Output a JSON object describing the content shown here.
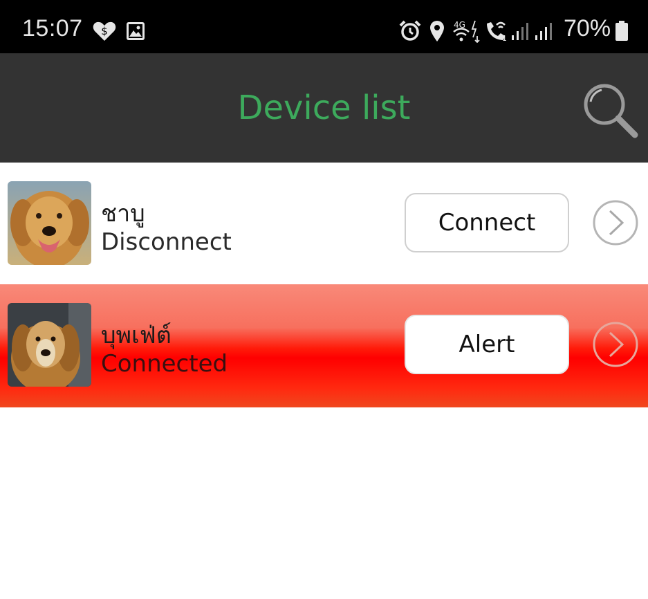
{
  "status_bar": {
    "time": "15:07",
    "battery": "70%",
    "left_icons": [
      "vpn-heart-icon",
      "image-icon"
    ],
    "right_icons": [
      "alarm-icon",
      "location-icon",
      "wifi-4g-icon",
      "wifi-call-icon",
      "signal-icon",
      "signal-icon",
      "battery-icon"
    ]
  },
  "header": {
    "title": "Device list",
    "title_color": "#3daa5c",
    "background": "#333333",
    "search_icon": "search-icon"
  },
  "devices": [
    {
      "name": "ชาบู",
      "status": "Disconnect",
      "action_label": "Connect",
      "row_color": "#ffffff",
      "avatar": "golden-retriever-photo"
    },
    {
      "name": "บุพเฟ่ต์",
      "status": "Connected",
      "action_label": "Alert",
      "row_color": "#ff0000",
      "avatar": "golden-retriever-photo"
    }
  ]
}
